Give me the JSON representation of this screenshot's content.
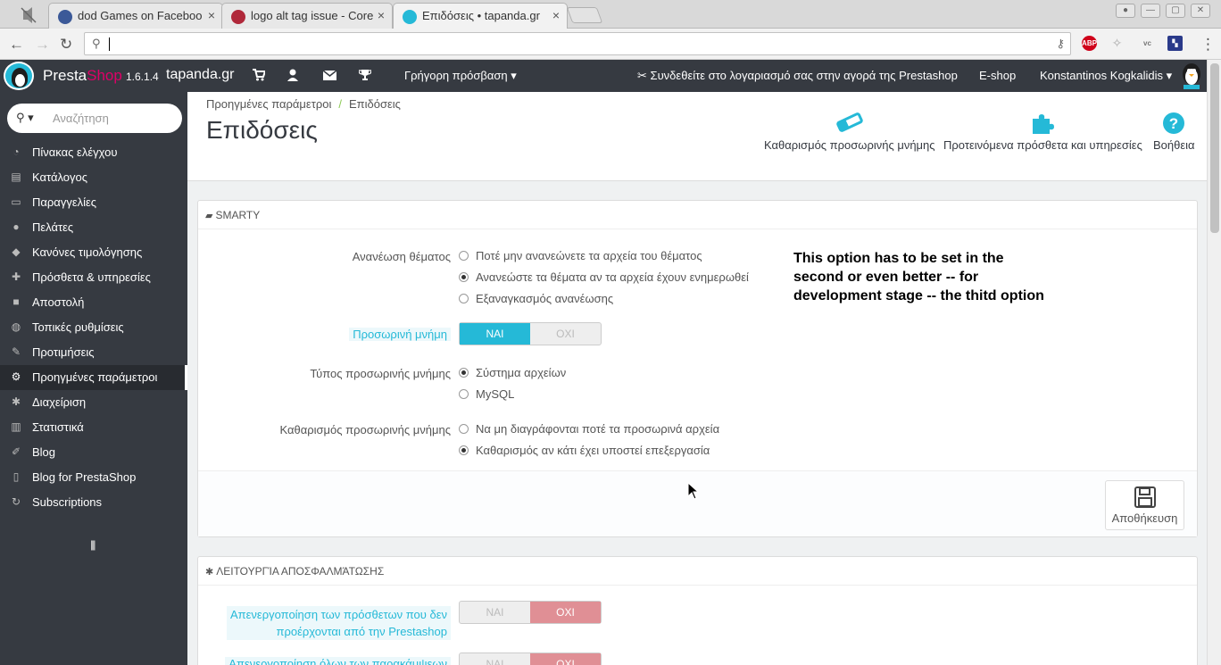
{
  "browser": {
    "tabs": [
      {
        "title": "dod Games on Faceboo",
        "active": false
      },
      {
        "title": "logo alt tag issue - Core",
        "active": false
      },
      {
        "title": "Επιδόσεις • tapanda.gr",
        "active": true
      }
    ],
    "tab_close_glyph": "×",
    "url": ""
  },
  "header": {
    "brand_presta": "Presta",
    "brand_shop": "Shop",
    "version": "1.6.1.4",
    "shop_name": "tapanda.gr",
    "quick_access": "Γρήγορη πρόσβαση",
    "addons_connect": "Συνδεθείτε στο λογαριασμό σας στην αγορά της Prestashop",
    "eshop": "E-shop",
    "user": "Konstantinos Kogkalidis"
  },
  "sidebar": {
    "search_placeholder": "Αναζήτηση",
    "items": [
      {
        "label": "Πίνακας ελέγχου",
        "icon": "dashboard-icon",
        "glyph": "◔"
      },
      {
        "label": "Κατάλογος",
        "icon": "book-icon",
        "glyph": "▤"
      },
      {
        "label": "Παραγγελίες",
        "icon": "credit-card-icon",
        "glyph": "▭"
      },
      {
        "label": "Πελάτες",
        "icon": "users-icon",
        "glyph": "●"
      },
      {
        "label": "Κανόνες τιμολόγησης",
        "icon": "tags-icon",
        "glyph": "◆"
      },
      {
        "label": "Πρόσθετα & υπηρεσίες",
        "icon": "puzzle-icon",
        "glyph": "✚"
      },
      {
        "label": "Αποστολή",
        "icon": "truck-icon",
        "glyph": "■"
      },
      {
        "label": "Τοπικές ρυθμίσεις",
        "icon": "globe-icon",
        "glyph": "◍"
      },
      {
        "label": "Προτιμήσεις",
        "icon": "wrench-icon",
        "glyph": "✎"
      },
      {
        "label": "Προηγμένες παράμετροι",
        "icon": "cogs-icon",
        "glyph": "⚙",
        "active": true
      },
      {
        "label": "Διαχείριση",
        "icon": "cog-icon",
        "glyph": "✱"
      },
      {
        "label": "Στατιστικά",
        "icon": "bar-chart-icon",
        "glyph": "▥"
      },
      {
        "label": "Blog",
        "icon": "pencil-icon",
        "glyph": "✐"
      },
      {
        "label": "Blog for PrestaShop",
        "icon": "file-icon",
        "glyph": "▯"
      },
      {
        "label": "Subscriptions",
        "icon": "refresh-icon",
        "glyph": "↻"
      }
    ]
  },
  "toolbar": {
    "breadcrumb_parent": "Προηγμένες παράμετροι",
    "breadcrumb_current": "Επιδόσεις",
    "title": "Επιδόσεις",
    "clear_cache": "Καθαρισμός προσωρινής μνήμης",
    "recommended_modules": "Προτεινόμενα πρόσθετα και υπηρεσίες",
    "help": "Βοήθεια"
  },
  "smarty": {
    "heading": "Smarty",
    "recompile_label": "Ανανέωση θέματος",
    "recompile_options": [
      {
        "label": "Ποτέ μην ανανεώνετε τα αρχεία του θέματος",
        "selected": false
      },
      {
        "label": "Ανανεώστε τα θέματα αν τα αρχεία έχουν ενημερωθεί",
        "selected": true
      },
      {
        "label": "Εξαναγκασμός ανανέωσης",
        "selected": false
      }
    ],
    "cache_label": "Προσωρινή μνήμη",
    "cache_yes": "ΝΑΙ",
    "cache_no": "ΟΧΙ",
    "cache_enabled": true,
    "cache_type_label": "Τύπος προσωρινής μνήμης",
    "cache_type_options": [
      {
        "label": "Σύστημα αρχείων",
        "selected": true
      },
      {
        "label": "MySQL",
        "selected": false
      }
    ],
    "clear_cache_label": "Καθαρισμός προσωρινής μνήμης",
    "clear_cache_options": [
      {
        "label": "Να μη διαγράφονται ποτέ τα προσωρινά αρχεία",
        "selected": false
      },
      {
        "label": "Καθαρισμός αν κάτι έχει υποστεί επεξεργασία",
        "selected": true
      }
    ],
    "save": "Αποθήκευση"
  },
  "annotation": "This option has to be set in the second or even better -- for development stage -- the thitd option",
  "debug": {
    "heading": "Λειτουργία αποσφαλμάτωσης",
    "disable_non_native_label_line1": "Απενεργοποίηση των πρόσθετων που δεν",
    "disable_non_native_label_line2": "προέρχονται από την Prestashop",
    "disable_overrides_label": "Απενεργοποίηση όλων των παρακάμψεων",
    "yes": "ΝΑΙ",
    "no": "ΟΧΙ"
  },
  "colors": {
    "accent": "#25b9d7",
    "header_bg": "#363a41",
    "brand_shop": "#df0067",
    "no_active": "#e08f95"
  }
}
